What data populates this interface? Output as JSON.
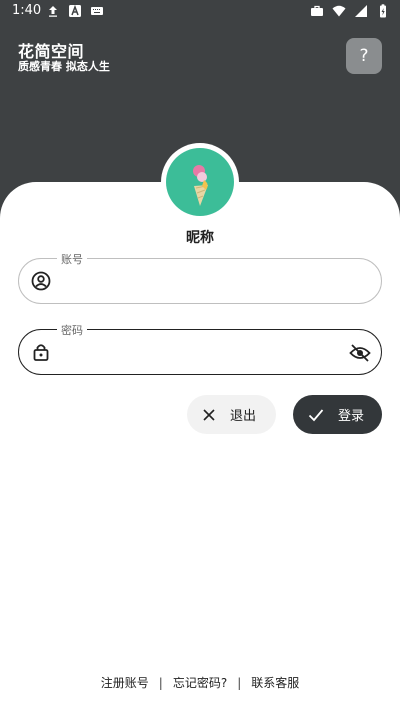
{
  "status_bar": {
    "time": "1:40"
  },
  "header": {
    "title": "花简空间",
    "subtitle": "质感青春 拟态人生",
    "help_label": "?"
  },
  "profile": {
    "nickname": "昵称"
  },
  "form": {
    "account_label": "账号",
    "account_value": "",
    "password_label": "密码",
    "password_value": ""
  },
  "buttons": {
    "exit_label": "退出",
    "login_label": "登录"
  },
  "footer": {
    "register_label": "注册账号",
    "forgot_label": "忘记密码?",
    "contact_label": "联系客服",
    "separator": "|"
  },
  "colors": {
    "header_bg": "#3e4143",
    "avatar_bg": "#3cbd98",
    "login_button_bg": "#33373a",
    "exit_button_bg": "#f2f2f2"
  },
  "icons": {
    "status_left": [
      "upload-icon",
      "text-a-icon",
      "keyboard-icon"
    ],
    "status_right": [
      "briefcase-icon",
      "wifi-icon",
      "signal-icon",
      "battery-icon"
    ],
    "account_field": "user-circle-icon",
    "password_field": "lock-icon",
    "password_toggle": "eye-off-icon",
    "exit_button": "close-icon",
    "login_button": "check-icon"
  }
}
